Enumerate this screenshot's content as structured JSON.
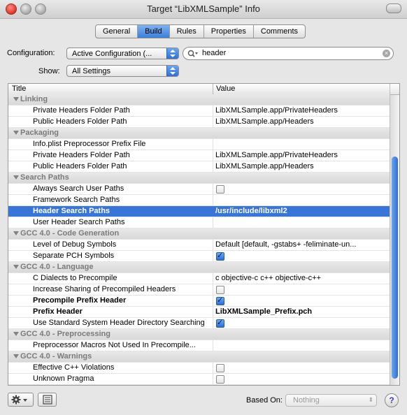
{
  "window": {
    "title": "Target “LibXMLSample” Info"
  },
  "tabs": [
    {
      "label": "General",
      "active": false
    },
    {
      "label": "Build",
      "active": true
    },
    {
      "label": "Rules",
      "active": false
    },
    {
      "label": "Properties",
      "active": false
    },
    {
      "label": "Comments",
      "active": false
    }
  ],
  "toolbar": {
    "configuration_label": "Configuration:",
    "configuration_value": "Active Configuration (...",
    "show_label": "Show:",
    "show_value": "All Settings",
    "search_value": "header"
  },
  "table": {
    "col_title": "Title",
    "col_value": "Value",
    "rows": [
      {
        "type": "group",
        "title": "Linking"
      },
      {
        "type": "item",
        "title": "Private Headers Folder Path",
        "value": "LibXMLSample.app/PrivateHeaders"
      },
      {
        "type": "item",
        "title": "Public Headers Folder Path",
        "value": "LibXMLSample.app/Headers"
      },
      {
        "type": "group",
        "title": "Packaging"
      },
      {
        "type": "item",
        "title": "Info.plist Preprocessor Prefix File",
        "value": ""
      },
      {
        "type": "item",
        "title": "Private Headers Folder Path",
        "value": "LibXMLSample.app/PrivateHeaders"
      },
      {
        "type": "item",
        "title": "Public Headers Folder Path",
        "value": "LibXMLSample.app/Headers"
      },
      {
        "type": "group",
        "title": "Search Paths"
      },
      {
        "type": "check",
        "title": "Always Search User Paths",
        "checked": false
      },
      {
        "type": "item",
        "title": "Framework Search Paths",
        "value": ""
      },
      {
        "type": "selected",
        "title": "Header Search Paths",
        "value": "/usr/include/libxml2"
      },
      {
        "type": "item",
        "title": "User Header Search Paths",
        "value": ""
      },
      {
        "type": "group",
        "title": "GCC 4.0 - Code Generation"
      },
      {
        "type": "item",
        "title": "Level of Debug Symbols",
        "value": "Default [default, -gstabs+ -feliminate-un..."
      },
      {
        "type": "check",
        "title": "Separate PCH Symbols",
        "checked": true
      },
      {
        "type": "group",
        "title": "GCC 4.0 - Language"
      },
      {
        "type": "item",
        "title": "C Dialects to Precompile",
        "value": "c objective-c c++ objective-c++"
      },
      {
        "type": "check",
        "title": "Increase Sharing of Precompiled Headers",
        "checked": false
      },
      {
        "type": "check",
        "title": "Precompile Prefix Header",
        "checked": true,
        "bold": true
      },
      {
        "type": "item",
        "title": "Prefix Header",
        "value": "LibXMLSample_Prefix.pch",
        "bold": true
      },
      {
        "type": "check",
        "title": "Use Standard System Header Directory Searching",
        "checked": true
      },
      {
        "type": "group",
        "title": "GCC 4.0 - Preprocessing"
      },
      {
        "type": "item",
        "title": "Preprocessor Macros Not Used In Precompile...",
        "value": ""
      },
      {
        "type": "group",
        "title": "GCC 4.0 - Warnings"
      },
      {
        "type": "check",
        "title": "Effective C++ Violations",
        "checked": false
      },
      {
        "type": "check",
        "title": "Unknown Pragma",
        "checked": false
      }
    ]
  },
  "bottom": {
    "based_on_label": "Based On:",
    "based_on_value": "Nothing",
    "help_label": "?"
  },
  "colors": {
    "selection": "#3875d7",
    "accent": "#2f6dd0"
  }
}
